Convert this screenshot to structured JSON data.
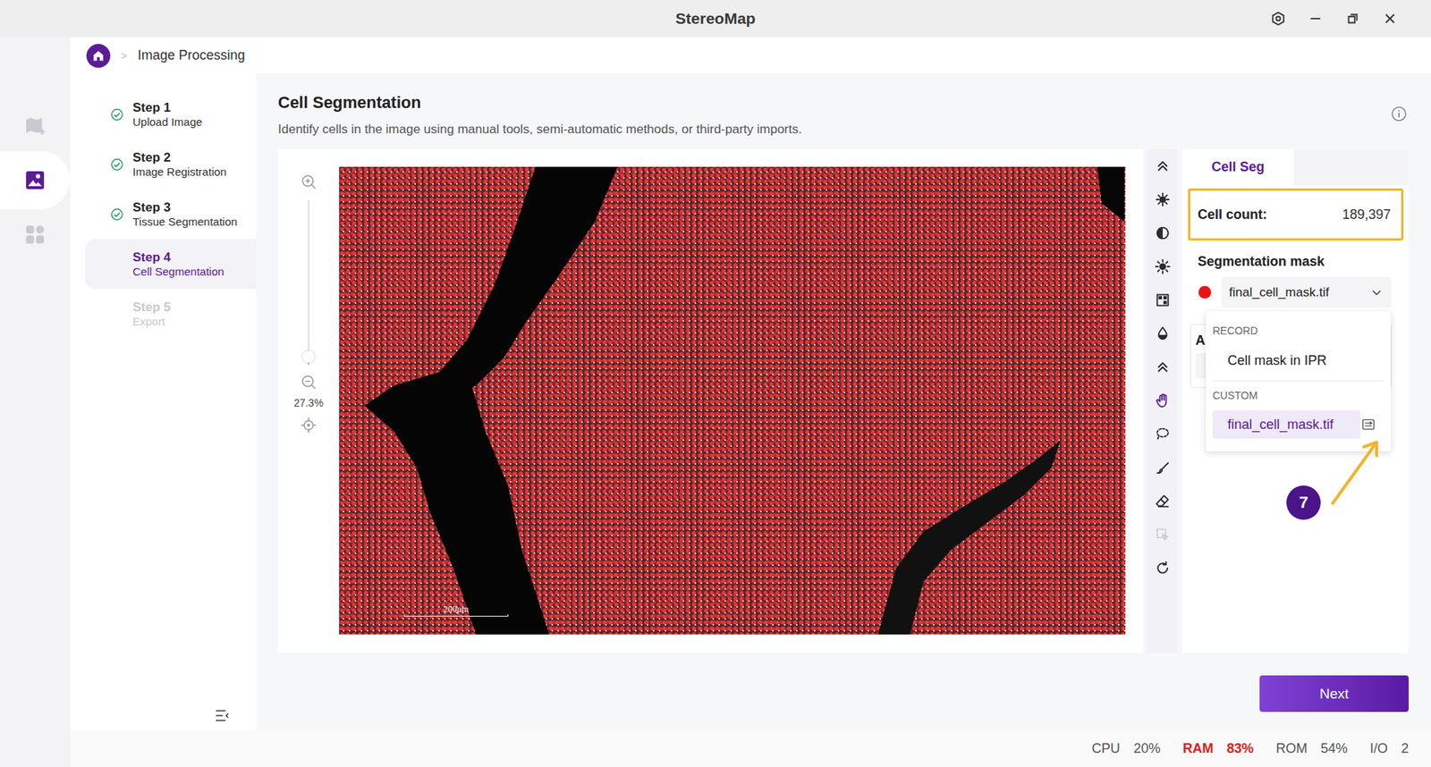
{
  "window": {
    "title": "StereoMap"
  },
  "rail": [
    {
      "selected": false
    },
    {
      "selected": true
    },
    {
      "selected": false
    }
  ],
  "breadcrumb": {
    "separator": ">",
    "label": "Image Processing"
  },
  "steps": [
    {
      "title": "Step 1",
      "subtitle": "Upload Image",
      "done": true,
      "selected": false,
      "disabled": false
    },
    {
      "title": "Step 2",
      "subtitle": "Image Registration",
      "done": true,
      "selected": false,
      "disabled": false
    },
    {
      "title": "Step 3",
      "subtitle": "Tissue Segmentation",
      "done": true,
      "selected": false,
      "disabled": false
    },
    {
      "title": "Step 4",
      "subtitle": "Cell Segmentation",
      "done": false,
      "selected": true,
      "disabled": false
    },
    {
      "title": "Step 5",
      "subtitle": "Export",
      "done": false,
      "selected": false,
      "disabled": true
    }
  ],
  "page": {
    "title": "Cell Segmentation",
    "description": "Identify cells in the image using manual tools, semi-automatic methods, or third-party imports."
  },
  "viewer": {
    "zoom": "27.3%",
    "level": 0.05,
    "scale_bar": "200μm"
  },
  "tools": [
    {
      "selected": false,
      "disabled": false
    },
    {
      "selected": false,
      "disabled": false
    },
    {
      "selected": false,
      "disabled": false
    },
    {
      "selected": false,
      "disabled": false
    },
    {
      "selected": false,
      "disabled": false
    },
    {
      "selected": false,
      "disabled": false
    },
    {
      "selected": false,
      "disabled": false
    },
    {
      "selected": true,
      "disabled": false
    },
    {
      "selected": false,
      "disabled": false
    },
    {
      "selected": false,
      "disabled": false
    },
    {
      "selected": false,
      "disabled": false
    },
    {
      "selected": false,
      "disabled": true
    },
    {
      "selected": false,
      "disabled": false
    }
  ],
  "panel": {
    "tabs": [
      {
        "label": "Cell Seg",
        "selected": true
      }
    ],
    "cell_count": {
      "label": "Cell count:",
      "value": "189,397"
    },
    "mask": {
      "label": "Segmentation mask",
      "value": "final_cell_mask.tif",
      "color": "#ee1111"
    },
    "hidden_section_label": "A",
    "menu": [
      {
        "label": "RECORD",
        "items": [
          {
            "label": "Cell mask in IPR",
            "selected": false,
            "editable": false
          }
        ]
      },
      {
        "label": "CUSTOM",
        "items": [
          {
            "label": "final_cell_mask.tif",
            "selected": true,
            "editable": true
          }
        ]
      }
    ]
  },
  "annotation": {
    "badge": "7"
  },
  "next_button": "Next",
  "status_bar": [
    {
      "label": "CPU",
      "value": "20%",
      "alert": false
    },
    {
      "label": "RAM",
      "value": "83%",
      "alert": true
    },
    {
      "label": "ROM",
      "value": "54%",
      "alert": false
    },
    {
      "label": "I/O",
      "value": "2",
      "alert": false
    }
  ]
}
